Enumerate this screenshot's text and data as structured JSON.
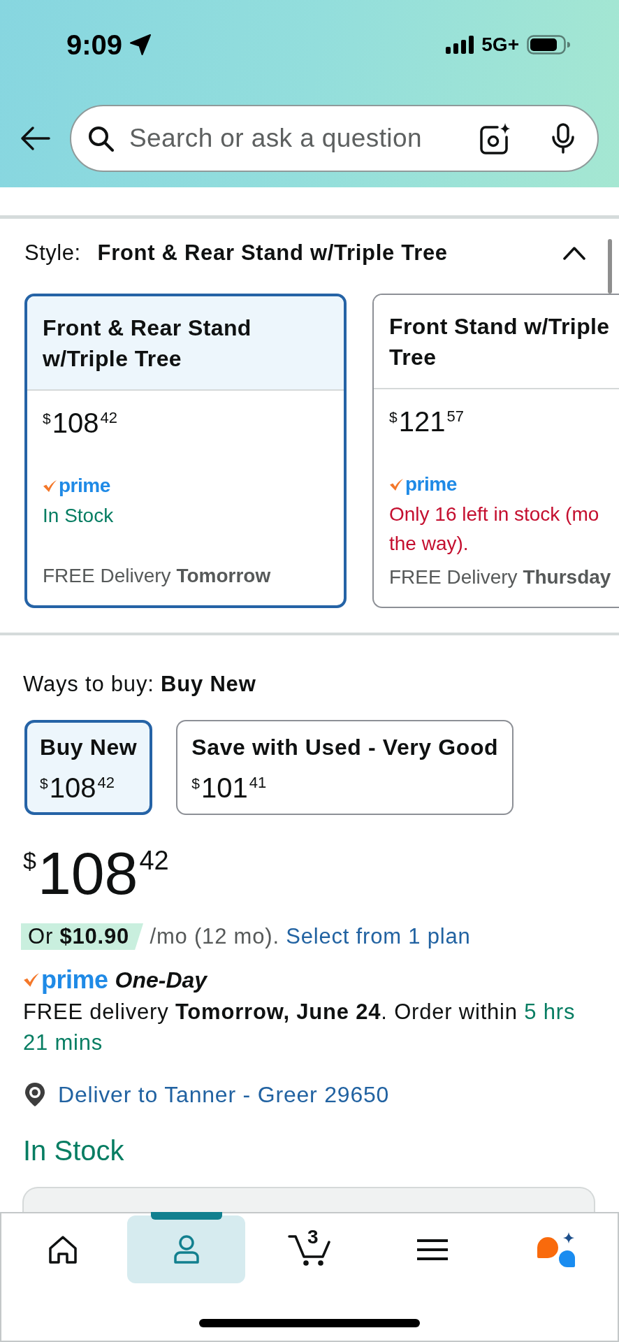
{
  "status_bar": {
    "time": "9:09",
    "network": "5G+"
  },
  "search": {
    "placeholder": "Search or ask a question"
  },
  "style": {
    "label": "Style:",
    "value": "Front & Rear Stand w/Triple Tree",
    "expanded": true,
    "options": [
      {
        "title_lines": [
          "Front & Rear Stand",
          "w/Triple Tree"
        ],
        "price": {
          "currency": "$",
          "whole": "108",
          "fraction": "42"
        },
        "badge": "prime",
        "kind": "in_stock",
        "stock_lines": [
          "In Stock"
        ],
        "delivery": "FREE Delivery **Tomorrow**",
        "selected": true
      },
      {
        "title_lines": [
          "Front Stand w/Triple",
          "Tree"
        ],
        "price": {
          "currency": "$",
          "whole": "121",
          "fraction": "57"
        },
        "badge": "prime",
        "kind": "low_stock",
        "stock_lines": [
          "Only 16 left in stock (mo",
          "the way)."
        ],
        "delivery": "FREE Delivery **Thursday**",
        "selected": false
      }
    ]
  },
  "ways_to_buy": {
    "label": "Ways to buy:",
    "value": "Buy New",
    "options": [
      {
        "label": "Buy New",
        "price": {
          "currency": "$",
          "whole": "108",
          "fraction": "42"
        },
        "selected": true
      },
      {
        "label": "Save with Used - Very Good",
        "price": {
          "currency": "$",
          "whole": "101",
          "fraction": "41"
        },
        "selected": false
      }
    ]
  },
  "price": {
    "currency": "$",
    "whole": "108",
    "fraction": "42"
  },
  "financing": {
    "offer": "Or **$10.90**",
    "terms": "/mo (12 mo).",
    "link": "Select from 1 plan"
  },
  "delivery": {
    "badge": "prime",
    "speed": "One-Day",
    "message": "FREE delivery **Tomorrow, June 24**. Order within",
    "countdown": "5 hrs 21 mins"
  },
  "location": {
    "link": "Deliver to Tanner - Greer 29650"
  },
  "availability": {
    "text": "In Stock",
    "kind": "in_stock"
  },
  "nav": [
    {
      "kind": "home",
      "selected": false
    },
    {
      "kind": "account",
      "selected": true
    },
    {
      "kind": "cart",
      "count": "3",
      "selected": false
    },
    {
      "kind": "menu",
      "selected": false
    },
    {
      "kind": "assistant",
      "selected": false
    }
  ]
}
